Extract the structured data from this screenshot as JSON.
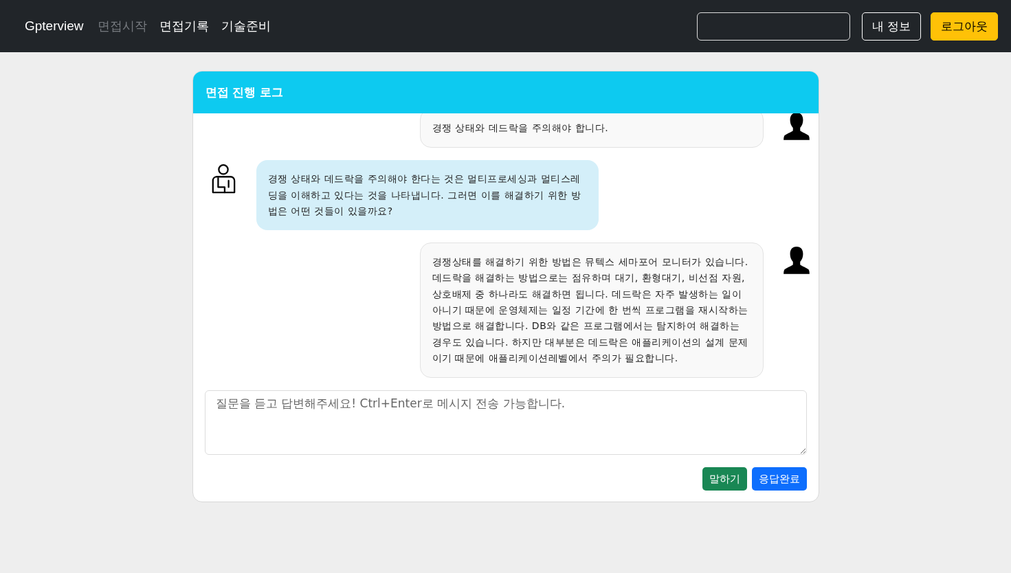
{
  "navbar": {
    "brand": "Gpterview",
    "links": [
      {
        "label": "면접시작",
        "disabled": true
      },
      {
        "label": "면접기록",
        "disabled": false
      },
      {
        "label": "기술준비",
        "disabled": false
      }
    ],
    "buttons": [
      {
        "label": "내 정보",
        "kind": "outline"
      },
      {
        "label": "로그아웃",
        "kind": "warning"
      }
    ]
  },
  "card": {
    "title": "면접 진행 로그",
    "messages": [
      {
        "kind": "user",
        "text": "경쟁 상태와 데드락을 주의해야 합니다."
      },
      {
        "kind": "bot",
        "text": "경쟁 상태와 데드락을 주의해야 한다는 것은 멀티프로세싱과 멀티스레딩을 이해하고 있다는 것을 나타냅니다. 그러면 이를 해결하기 위한 방법은 어떤 것들이 있을까요?"
      },
      {
        "kind": "user",
        "text": "경쟁상태를 해결하기 위한 방법은 뮤텍스 세마포어 모니터가 있습니다. 데드락을 해결하는 방법으로는 점유하며 대기, 환형대기, 비선점 자원, 상호배제 중 하나라도 해결하면 됩니다. 데드락은 자주 발생하는 일이 아니기 때문에 운영체제는 일정 기간에 한 번씩 프로그램을 재시작하는 방법으로 해결합니다. DB와 같은 프로그램에서는 탐지하여 해결하는 경우도 있습니다. 하지만 대부분은 데드락은 애플리케이션의 설계 문제이기 때문에 애플리케이션레벨에서 주의가 필요합니다."
      }
    ],
    "input": {
      "placeholder": "질문을 듣고 답변해주세요! Ctrl+Enter로 메시지 전송 가능합니다."
    },
    "actions": [
      {
        "label": "말하기",
        "kind": "success"
      },
      {
        "label": "응답완료",
        "kind": "primary"
      }
    ]
  }
}
